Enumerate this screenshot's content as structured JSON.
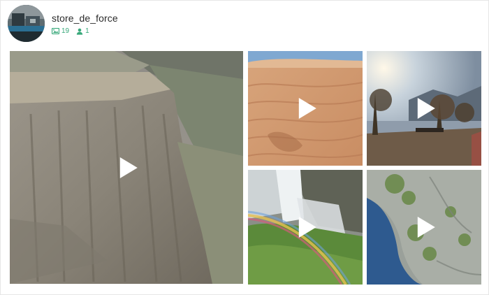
{
  "profile": {
    "username": "store_de_force",
    "posts_count": "19",
    "followers_count": "1",
    "avatar_icon": "profile-photo"
  },
  "colors": {
    "accent": "#38a87a",
    "username": "#2b2b2b"
  },
  "gallery": {
    "items": [
      {
        "name": "canyon-cliff-video",
        "type": "video"
      },
      {
        "name": "desert-dunes-video",
        "type": "video"
      },
      {
        "name": "lakeside-trees-video",
        "type": "video"
      },
      {
        "name": "waterfall-rainbow-video",
        "type": "video"
      },
      {
        "name": "aerial-coast-video",
        "type": "video"
      }
    ]
  }
}
